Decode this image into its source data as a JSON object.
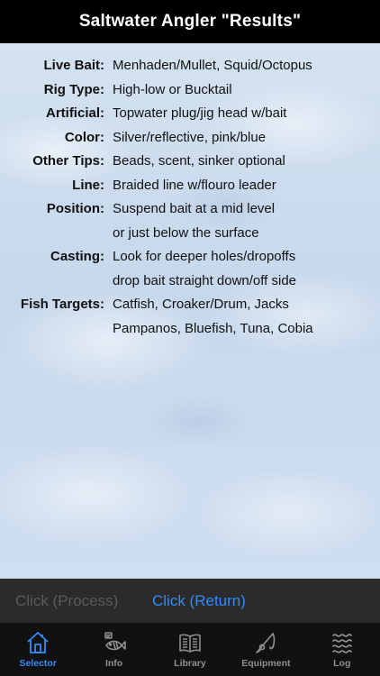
{
  "header": {
    "title": "Saltwater Angler \"Results\""
  },
  "results": [
    {
      "label": "Live Bait:",
      "lines": [
        "Menhaden/Mullet, Squid/Octopus"
      ]
    },
    {
      "label": "Rig Type:",
      "lines": [
        "High-low or Bucktail"
      ]
    },
    {
      "label": "Artificial:",
      "lines": [
        "Topwater plug/jig head w/bait"
      ]
    },
    {
      "label": "Color:",
      "lines": [
        "Silver/reflective, pink/blue"
      ]
    },
    {
      "label": "Other Tips:",
      "lines": [
        "Beads, scent, sinker optional"
      ]
    },
    {
      "label": "Line:",
      "lines": [
        "Braided line w/flouro leader"
      ]
    },
    {
      "label": "Position:",
      "lines": [
        "Suspend bait at a mid level",
        "or just below the surface"
      ]
    },
    {
      "label": "Casting:",
      "lines": [
        "Look for deeper holes/dropoffs",
        "drop bait straight down/off side"
      ]
    },
    {
      "label": "Fish Targets:",
      "lines": [
        "Catfish, Croaker/Drum, Jacks",
        "Pampanos, Bluefish, Tuna, Cobia"
      ]
    }
  ],
  "actions": {
    "process_label": "Click (Process)",
    "return_label": "Click (Return)"
  },
  "tabs": [
    {
      "label": "Selector",
      "icon": "house-icon",
      "active": true
    },
    {
      "label": "Info",
      "icon": "fish-icon",
      "active": false
    },
    {
      "label": "Library",
      "icon": "book-icon",
      "active": false
    },
    {
      "label": "Equipment",
      "icon": "fishing-rod-icon",
      "active": false
    },
    {
      "label": "Log",
      "icon": "waves-icon",
      "active": false
    }
  ],
  "colors": {
    "accent": "#2f8cff",
    "header_bg": "#000000",
    "action_bar_bg": "#2b2b2b",
    "tabbar_bg": "#111111",
    "disabled_text": "#5a5a5a",
    "inactive_tab": "#8e8e8e"
  }
}
